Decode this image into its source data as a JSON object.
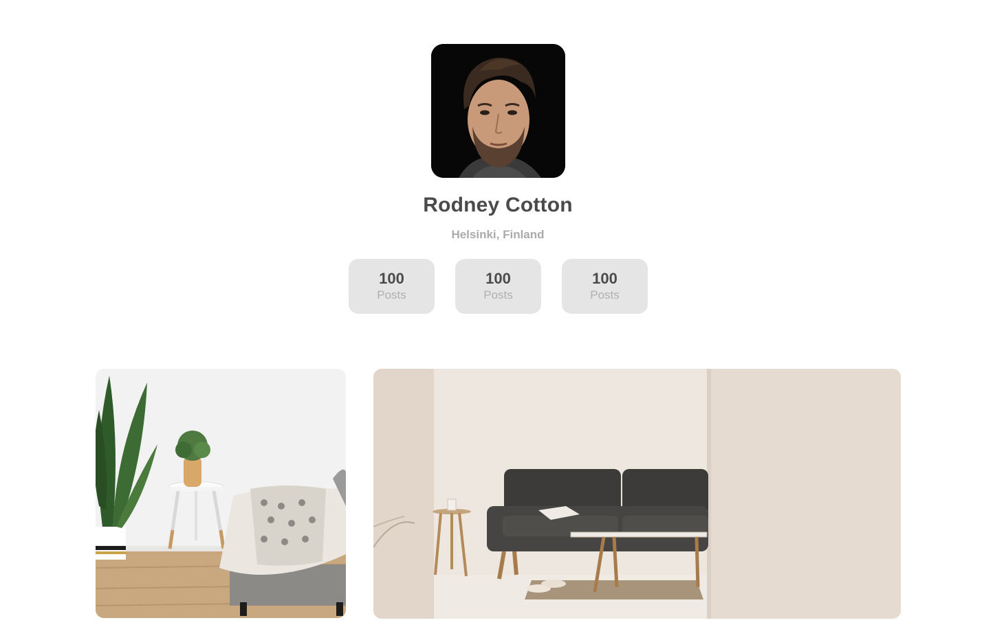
{
  "profile": {
    "name": "Rodney Cotton",
    "location": "Helsinki, Finland",
    "avatar_alt": "portrait photo of man with beard"
  },
  "stats": [
    {
      "value": "100",
      "label": "Posts"
    },
    {
      "value": "100",
      "label": "Posts"
    },
    {
      "value": "100",
      "label": "Posts"
    }
  ],
  "gallery": [
    {
      "alt": "living room corner with plant, side table and sofa with blanket"
    },
    {
      "alt": "minimal living room with dark grey sofa and coffee table"
    }
  ],
  "colors": {
    "stat_bg": "#e5e5e5",
    "name_text": "#4a4a4a",
    "location_text": "#ababab"
  }
}
